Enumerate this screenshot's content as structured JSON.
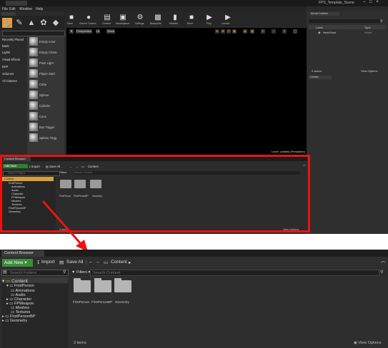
{
  "editor": {
    "window_title": "FPS_Template_Scene",
    "menu": [
      "File",
      "Edit",
      "Window",
      "Help"
    ],
    "toolbar": [
      "Save",
      "Source Control",
      "Content",
      "Marketplace",
      "Settings",
      "Blueprints",
      "Matinee",
      "Build",
      "Play",
      "Launch"
    ],
    "place_search_placeholder": "Search Classes",
    "place_categories": [
      "Recently Placed",
      "Basic",
      "Lights",
      "Visual Effects",
      "BSP",
      "Volumes",
      "All Classes"
    ],
    "place_items": [
      "Empty Actor",
      "Empty Chara",
      "Point Light",
      "Player Start",
      "Cube",
      "Sphere",
      "Cylinder",
      "Cone",
      "Box Trigger",
      "Sphere Trigg"
    ],
    "viewport_buttons": [
      "Perspective",
      "Lit",
      "Show"
    ],
    "level_status": "Level:  Untitled (Persistent)",
    "outliner": {
      "tab": "World Outliner",
      "col_label": "Label",
      "col_type": "Type",
      "row_label": "NewWorld",
      "row_type": "World",
      "actor_count": "0 actors",
      "view_options": "View Options"
    },
    "details_tab": "Details"
  },
  "cb_small": {
    "tab": "Content Browser",
    "add_new": "Add New",
    "import": "Import",
    "save_all": "Save All",
    "path": "Content",
    "search_folders": "Search Folders",
    "filters": "Filters",
    "search_content": "Search Content",
    "tree": [
      "Content",
      "FirstPerson",
      "Animations",
      "Audio",
      "Character",
      "FPWeapon",
      "Meshes",
      "Textures",
      "FirstPersonBP",
      "Geometry"
    ],
    "folders": [
      "FirstPerson",
      "FirstPersonBP",
      "Geometry"
    ],
    "item_count": "3 items",
    "view_options": "View Options"
  },
  "cb_zoom": {
    "tab": "Content Browser",
    "add_new": "Add New",
    "import": "Import",
    "save_all": "Save All",
    "path": "Content",
    "search_folders": "Search Folders",
    "filters": "Filters",
    "search_content": "Search Content",
    "tree": [
      "Content",
      "FirstPerson",
      "Animations",
      "Audio",
      "Character",
      "FPWeapon",
      "Meshes",
      "Textures",
      "FirstPersonBP",
      "Geometry"
    ],
    "folders": [
      "FirstPerson",
      "FirstPersonBP",
      "Geometry"
    ],
    "item_count": "3 items",
    "view_options": "View Options"
  },
  "colors": {
    "highlight": "#e11111",
    "add_new_green": "#3b8d3b",
    "content_selected": "#d8a03a"
  }
}
